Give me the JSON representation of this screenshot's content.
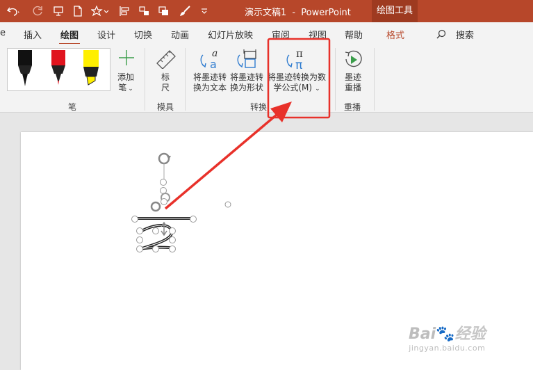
{
  "titlebar": {
    "doc_title": "演示文稿1",
    "separator": "-",
    "app_name": "PowerPoint",
    "context_tab": "绘图工具",
    "icons": [
      "undo-icon",
      "redo-icon",
      "present-icon",
      "new-file-icon",
      "star-icon",
      "align-icon",
      "group-icon",
      "layers-icon",
      "brush-icon",
      "customize-qat-icon"
    ]
  },
  "tabs": {
    "cut_left": "e",
    "insert": "插入",
    "draw": "绘图",
    "design": "设计",
    "transitions": "切换",
    "animations": "动画",
    "slideshow": "幻灯片放映",
    "review": "审阅",
    "view": "视图",
    "help": "帮助",
    "format": "格式",
    "search": "搜索"
  },
  "ribbon": {
    "pens": {
      "group_label": "笔",
      "add_pen_line1": "添加",
      "add_pen_line2": "笔",
      "items": [
        {
          "name": "black-pen",
          "color": "#111111"
        },
        {
          "name": "red-pen",
          "color": "#e0141e"
        },
        {
          "name": "yellow-highlighter",
          "color": "#ffef00"
        }
      ]
    },
    "stencils": {
      "group_label": "模具",
      "ruler_line1": "标",
      "ruler_line2": "尺"
    },
    "convert": {
      "group_label": "转换",
      "ink_to_text_line1": "将墨迹转",
      "ink_to_text_line2": "换为文本",
      "ink_to_shape_line1": "将墨迹转",
      "ink_to_shape_line2": "换为形状",
      "ink_to_math_line1": "将墨迹转换为数",
      "ink_to_math_line2": "学公式(M)",
      "text_glyph": "a",
      "math_glyph": "π"
    },
    "replay": {
      "group_label": "重播",
      "ink_replay_line1": "墨迹",
      "ink_replay_line2": "重播"
    }
  },
  "annotation": {
    "highlight_color": "#e8312a",
    "arrow_color": "#e8312a"
  },
  "watermark": {
    "brand": "Bai",
    "brand_accent": "经验",
    "url": "jingyan.baidu.com"
  }
}
